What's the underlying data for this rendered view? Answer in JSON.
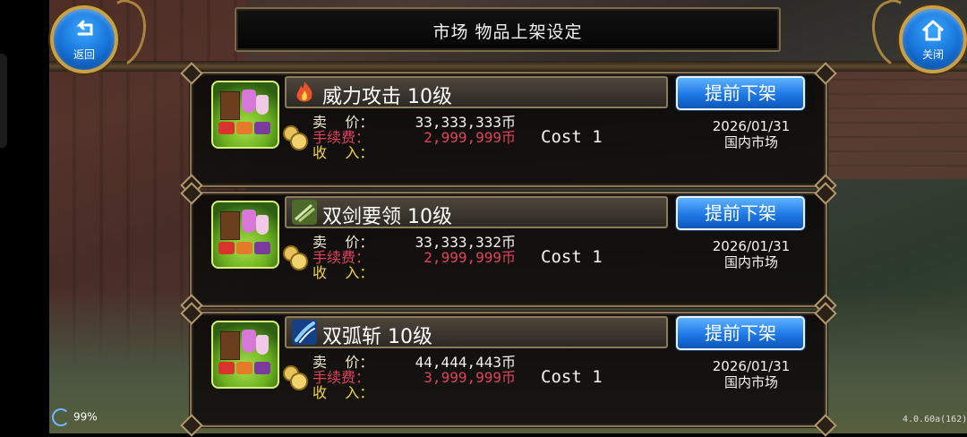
{
  "header": {
    "title": "市场  物品上架设定",
    "back_label": "返回",
    "close_label": "关闭"
  },
  "listings": [
    {
      "name": "威力攻击  10级",
      "skill_icon": "fire-icon",
      "skill_color": "#e8552a",
      "delist_label": "提前下架",
      "price_label": "卖    价：",
      "price": "33,333,333币",
      "fee_label": "手续费：",
      "fee": "2,999,999币",
      "income_label": "收    入：",
      "income": "",
      "cost": "Cost  1",
      "date": "2026/01/31",
      "market": "国内市场"
    },
    {
      "name": "双剑要领  10级",
      "skill_icon": "twin-swords-icon",
      "skill_color": "#6a8a3a",
      "delist_label": "提前下架",
      "price_label": "卖    价：",
      "price": "33,333,332币",
      "fee_label": "手续费：",
      "fee": "2,999,999币",
      "income_label": "收    入：",
      "income": "",
      "cost": "Cost  1",
      "date": "2026/01/31",
      "market": "国内市场"
    },
    {
      "name": "双弧斩  10级",
      "skill_icon": "slash-icon",
      "skill_color": "#2f6fd8",
      "delist_label": "提前下架",
      "price_label": "卖    价：",
      "price": "44,444,443币",
      "fee_label": "手续费：",
      "fee": "3,999,999币",
      "income_label": "收    入：",
      "income": "",
      "cost": "Cost  1",
      "date": "2026/01/31",
      "market": "国内市场"
    }
  ],
  "status": {
    "battery": "99%",
    "version": "4.0.60a(162)"
  },
  "colors": {
    "delist_button": "#1e78e6",
    "fee_red": "#e0435a",
    "income_yellow": "#f0d34a",
    "frame_gold": "#8a7656"
  }
}
